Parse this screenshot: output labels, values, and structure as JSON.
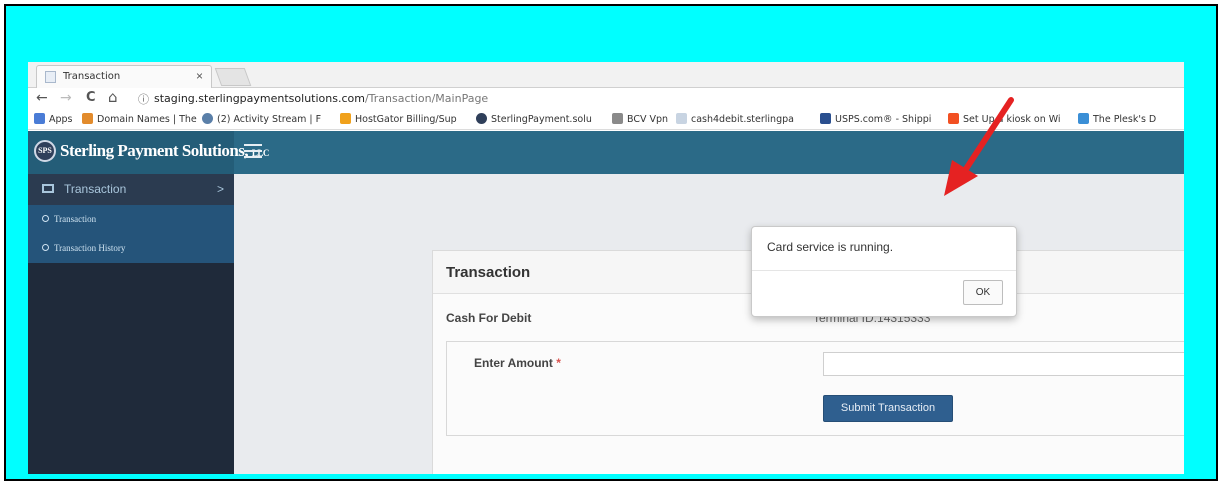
{
  "browser": {
    "tab_title": "Transaction",
    "tab_close": "×",
    "url_host": "staging.sterlingpaymentsolutions.com",
    "url_path": "/Transaction/MainPage",
    "nav_back": "←",
    "nav_forward": "→",
    "nav_reload": "C",
    "nav_home": "⌂",
    "info_icon": "ⓘ"
  },
  "bookmarks": [
    {
      "label": "Apps",
      "icon": "apps-grid-icon",
      "color": "#4a7cd6"
    },
    {
      "label": "Domain Names | The",
      "icon": "domain-icon",
      "color": "#e28b2c"
    },
    {
      "label": "(2) Activity Stream | F",
      "icon": "activity-icon",
      "color": "#5a7fa8"
    },
    {
      "label": "HostGator Billing/Sup",
      "icon": "hostgator-icon",
      "color": "#f0a11c"
    },
    {
      "label": "SterlingPayment.solu",
      "icon": "sps-icon",
      "color": "#2f3f5a"
    },
    {
      "label": "BCV Vpn",
      "icon": "vpn-icon",
      "color": "#8a8a8a"
    },
    {
      "label": "cash4debit.sterlingpa",
      "icon": "page-icon",
      "color": "#c8d4e2"
    },
    {
      "label": "USPS.com® - Shippi",
      "icon": "usps-icon",
      "color": "#2a4f8f"
    },
    {
      "label": "Set Up a kiosk on Wi",
      "icon": "windows-icon",
      "color": "#f25022"
    },
    {
      "label": "The Plesk's D",
      "icon": "plesk-icon",
      "color": "#3b8fd6"
    }
  ],
  "brand": {
    "logo_text": "SPS",
    "name": "Sterling Payment Solutions,",
    "suffix": "LLC"
  },
  "sidebar": {
    "main_label": "Transaction",
    "main_chevron": ">",
    "items": [
      {
        "label": "Transaction"
      },
      {
        "label": "Transaction History"
      }
    ]
  },
  "panel": {
    "title": "Transaction",
    "left_label": "Cash For Debit",
    "terminal": "Terminal ID:14315333",
    "amount_label": "Enter Amount",
    "required_mark": "*",
    "amount_value": "",
    "submit_label": "Submit Transaction"
  },
  "dialog": {
    "message": "Card service is running.",
    "ok_label": "OK"
  },
  "colors": {
    "frame": "#00ffff",
    "topbar": "#2b6a87",
    "sidebar": "#1f2a3a",
    "submit": "#2f5f8f",
    "arrow": "#e52222"
  }
}
